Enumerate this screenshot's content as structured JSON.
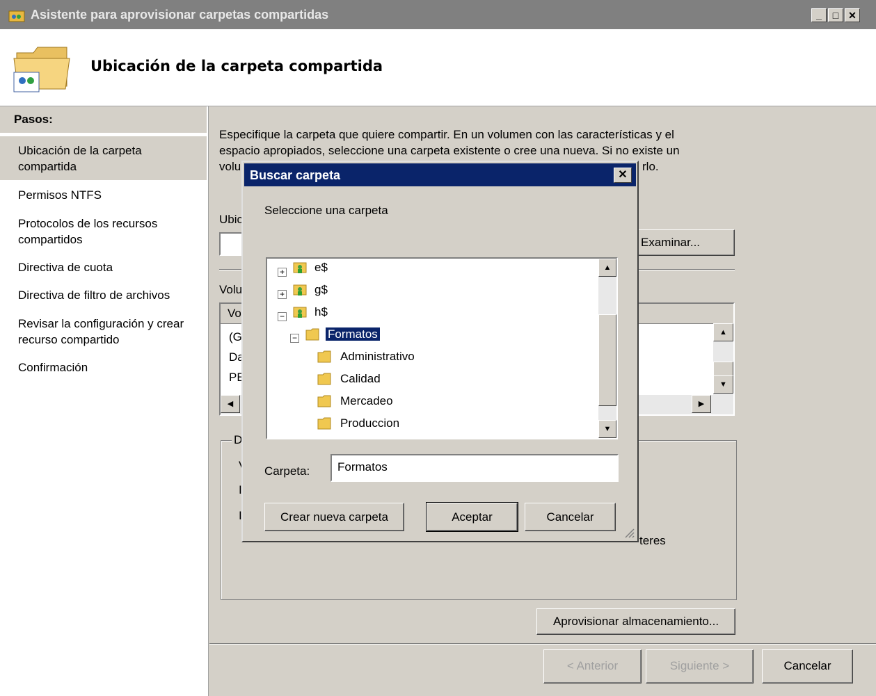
{
  "window": {
    "title": "Asistente para aprovisionar carpetas compartidas"
  },
  "header": {
    "title": "Ubicación de la carpeta compartida"
  },
  "steps": {
    "heading": "Pasos:",
    "items": [
      {
        "line1": "Ubicación de la carpeta",
        "line2": "compartida"
      },
      {
        "line1": "Permisos NTFS",
        "line2": ""
      },
      {
        "line1": "Protocolos de los recursos",
        "line2": "compartidos"
      },
      {
        "line1": "Directiva de cuota",
        "line2": ""
      },
      {
        "line1": "Directiva de filtro de archivos",
        "line2": ""
      },
      {
        "line1": "Revisar la configuración y crear",
        "line2": "recurso compartido"
      },
      {
        "line1": "Confirmación",
        "line2": ""
      }
    ]
  },
  "main": {
    "desc_line1": "Especifique la carpeta que quiere compartir. En un volumen con las características y el",
    "desc_line2": "espacio apropiados, seleccione una carpeta existente o cree una nueva. Si no existe un",
    "desc_line3_left": "volu",
    "desc_line3_right": "rlo.",
    "location_label": "Ubic",
    "browse_button": "Examinar...",
    "volumes_label": "Volu",
    "col_header": "Vo",
    "rows": [
      "(G",
      "Da",
      "PE"
    ],
    "details_label": "D",
    "details_lines": [
      "V",
      "I",
      "I"
    ],
    "cluster_text": "teres",
    "provision_button": "Aprovisionar almacenamiento..."
  },
  "footer": {
    "back": "< Anterior",
    "next": "Siguiente >",
    "cancel": "Cancelar"
  },
  "dialog": {
    "title": "Buscar carpeta",
    "prompt": "Seleccione una carpeta",
    "tree": {
      "e": "e$",
      "g": "g$",
      "h": "h$",
      "formatos": "Formatos",
      "children": [
        "Administrativo",
        "Calidad",
        "Mercadeo",
        "Produccion"
      ]
    },
    "folder_label": "Carpeta:",
    "folder_value": "Formatos",
    "new_folder_button": "Crear nueva carpeta",
    "ok_button": "Aceptar",
    "cancel_button": "Cancelar"
  }
}
